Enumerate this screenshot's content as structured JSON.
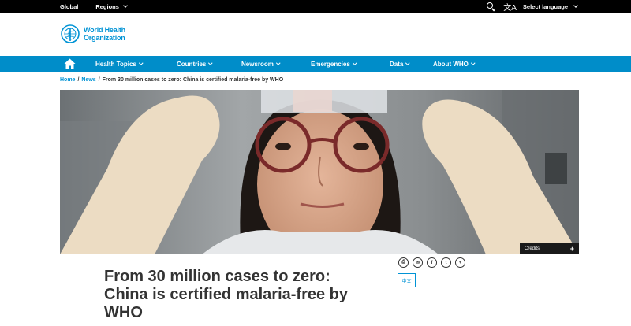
{
  "topbar": {
    "global": "Global",
    "regions": "Regions",
    "select_language": "Select language",
    "search_icon": "search-icon",
    "translate_icon": "translate-icon"
  },
  "logo": {
    "line1": "World Health",
    "line2": "Organization"
  },
  "nav": {
    "home_icon": "home-icon",
    "items": [
      {
        "label": "Health Topics"
      },
      {
        "label": "Countries"
      },
      {
        "label": "Newsroom"
      },
      {
        "label": "Emergencies"
      },
      {
        "label": "Data"
      },
      {
        "label": "About WHO"
      }
    ],
    "color": "#008dc9"
  },
  "breadcrumb": {
    "home": "Home",
    "news": "News",
    "current": "From 30 million cases to zero: China is certified malaria-free by WHO"
  },
  "hero": {
    "credits_label": "Credits",
    "credits_expand": "+"
  },
  "article": {
    "title": "From 30 million cases to zero: China is certified malaria-free by WHO"
  },
  "share": {
    "icons": [
      "print-icon",
      "email-icon",
      "facebook-icon",
      "twitter-icon",
      "more-icon"
    ],
    "glyphs": [
      "⎙",
      "✉",
      "f",
      "t",
      "+"
    ],
    "language_button": "中文"
  },
  "colors": {
    "brand_blue": "#0093d5",
    "text": "#333333"
  }
}
